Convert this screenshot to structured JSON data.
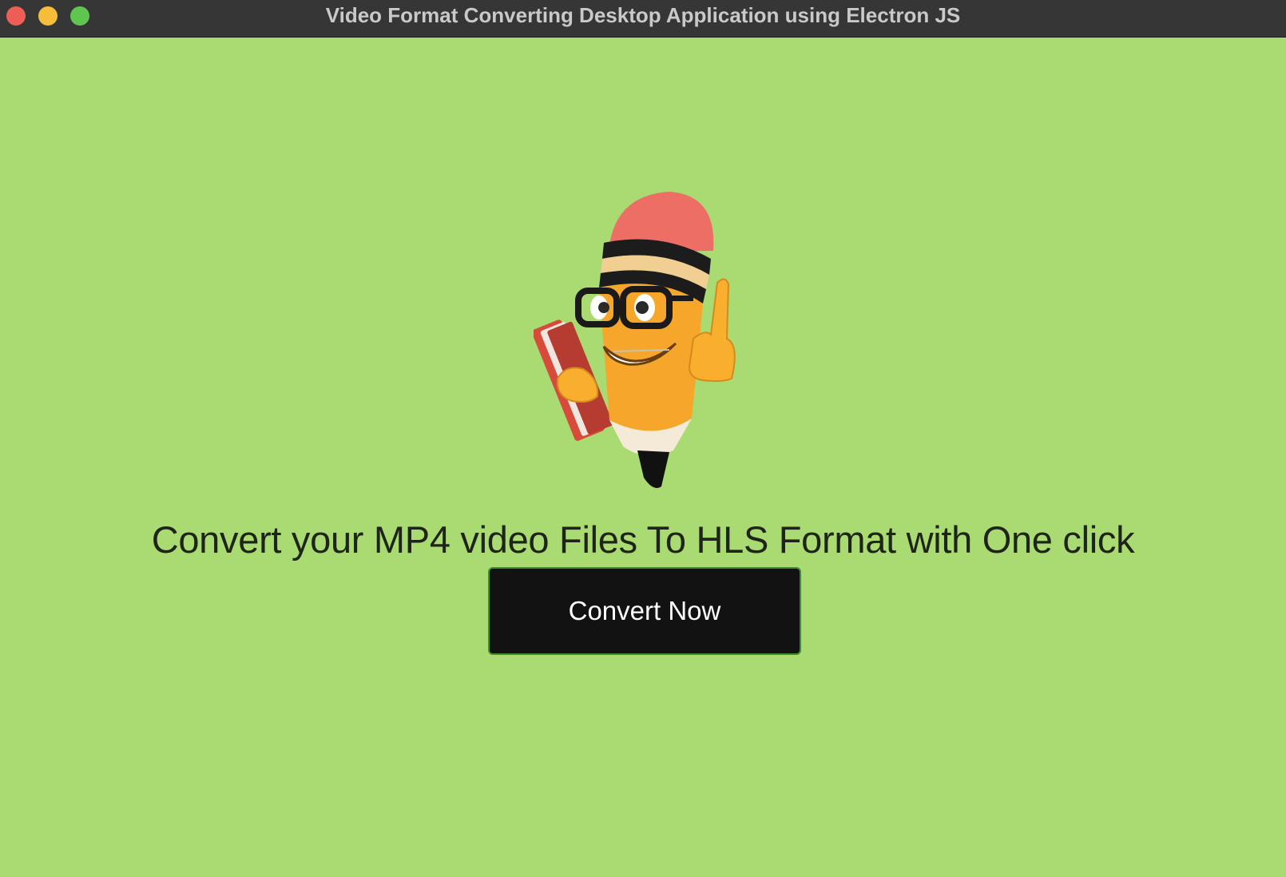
{
  "window": {
    "title": "Video Format Converting Desktop Application using Electron JS",
    "controls": {
      "close_color": "#ee5e56",
      "minimize_color": "#f6bd3b",
      "zoom_color": "#5ec64f"
    }
  },
  "theme": {
    "background": "#a9db72",
    "button_background": "#121212",
    "button_border": "#3f8f2f"
  },
  "main": {
    "mascot_icon": "pencil-mascot-thumbs-up",
    "headline": "Convert your MP4 video Files To HLS Format with One click",
    "convert_button_label": "Convert Now"
  }
}
